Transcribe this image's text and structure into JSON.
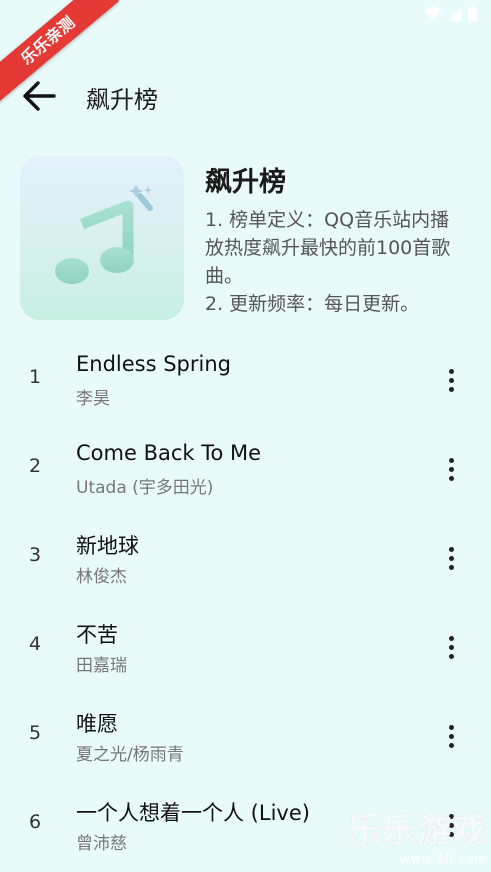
{
  "badge": {
    "text": "乐乐亲测"
  },
  "status_bar": {
    "icons": [
      "wifi-icon",
      "signal-icon",
      "battery-icon"
    ]
  },
  "header": {
    "title": "飙升榜",
    "back_icon": "arrow-left-icon"
  },
  "playlist": {
    "cover_icon": "music-note-icon",
    "title": "飙升榜",
    "description": "1. 榜单定义：QQ音乐站内播放热度飙升最快的前100首歌曲。\n2. 更新频率：每日更新。"
  },
  "songs": [
    {
      "rank": "1",
      "title": "Endless Spring",
      "artist": "李昊"
    },
    {
      "rank": "2",
      "title": "Come Back To Me",
      "artist": "Utada (宇多田光)"
    },
    {
      "rank": "3",
      "title": "新地球",
      "artist": "林俊杰"
    },
    {
      "rank": "4",
      "title": "不苦",
      "artist": "田嘉瑞"
    },
    {
      "rank": "5",
      "title": "唯愿",
      "artist": "夏之光/杨雨青"
    },
    {
      "rank": "6",
      "title": "一个人想着一个人 (Live)",
      "artist": "曾沛慈"
    }
  ],
  "watermark": {
    "text": "乐乐游戏",
    "url": "www.6ll.com"
  },
  "colors": {
    "background": "#e8fbfa",
    "badge": "#e53935",
    "note": "#8fd3bf"
  }
}
